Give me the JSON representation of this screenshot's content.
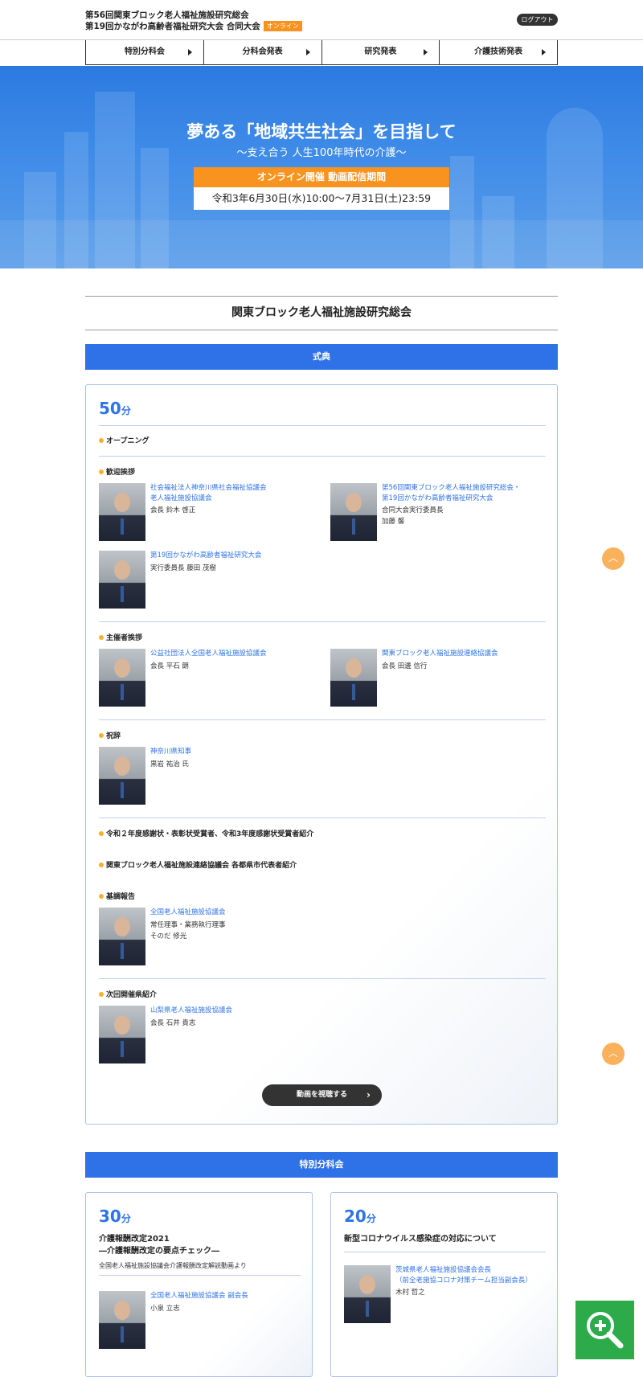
{
  "header": {
    "title_line1": "第56回関東ブロック老人福祉施設研究総会",
    "title_line2": "第19回かながわ高齢者福祉研究大会 合同大会",
    "online_badge": "オンライン",
    "logout": "ログアウト"
  },
  "nav": {
    "items": [
      {
        "label": "特別分科会"
      },
      {
        "label": "分科会発表"
      },
      {
        "label": "研究発表"
      },
      {
        "label": "介護技術発表"
      }
    ]
  },
  "hero": {
    "title": "夢ある「地域共生社会」を目指して",
    "subtitle": "〜支え合う 人生100年時代の介護〜",
    "period_label": "オンライン開催 動画配信期間",
    "period_dates": "令和3年6月30日(水)10:00〜7月31日(土)23:59"
  },
  "section_title": "関東ブロック老人福祉施設研究総会",
  "ceremony": {
    "bar": "式典",
    "duration_num": "50",
    "duration_unit": "分",
    "opening": "オープニング",
    "welcome": {
      "label": "歓迎挨拶",
      "p1_org": "社会福祉法人神奈川県社会福祉協議会\n老人福祉施設協議会",
      "p1_name": "会長 鈴木 啓正",
      "p2_org": "第56回関東ブロック老人福祉施設研究総会・\n第19回かながわ高齢者福祉研究大会",
      "p2_name": "合同大会実行委員長\n加藤 馨",
      "p3_org": "第19回かながわ高齢者福祉研究大会",
      "p3_name": "実行委員長 藤田 茂樹"
    },
    "host": {
      "label": "主催者挨拶",
      "p1_org": "公益社団法人全国老人福祉施設協議会",
      "p1_name": "会長 平石 朗",
      "p2_org": "関東ブロック老人福祉施設連絡協議会",
      "p2_name": "会長 田邊 信行"
    },
    "congrats": {
      "label": "祝辞",
      "p1_org": "神奈川県知事",
      "p1_name": "黒岩 祐治 氏"
    },
    "awards": "令和２年度感謝状・表彰状受賞者、令和3年度感謝状受賞者紹介",
    "reps": "関東ブロック老人福祉施設連絡協議会 各都県市代表者紹介",
    "keynote": {
      "label": "基調報告",
      "p1_org": "全国老人福祉施設協議会",
      "p1_name": "常任理事・業務執行理事\nそのだ 修光"
    },
    "next": {
      "label": "次回開催県紹介",
      "p1_org": "山梨県老人福祉施設協議会",
      "p1_name": "会長 石井 貴志"
    },
    "watch_button": "動画を視聴する"
  },
  "special": {
    "bar": "特別分科会",
    "card1": {
      "duration_num": "30",
      "duration_unit": "分",
      "title": "介護報酬改定2021\n―介護報酬改定の要点チェック―",
      "note": "全国老人福祉施設協議会介護報酬改定解説動画より",
      "org": "全国老人福祉施設協議会 副会長",
      "name": "小泉 立志"
    },
    "card2": {
      "duration_num": "20",
      "duration_unit": "分",
      "title": "新型コロナウイルス感染症の対応について",
      "org": "茨城県老人福祉施設協議会会長\n（前全老施協コロナ対策チーム担当副会長）",
      "name": "木村 哲之"
    }
  },
  "colors": {
    "accent": "#2f72e8",
    "orange": "#f7931e",
    "green": "#2dab4a"
  },
  "icons": [
    "chevron-right-icon",
    "chevron-up-icon",
    "zoom-in-icon"
  ]
}
